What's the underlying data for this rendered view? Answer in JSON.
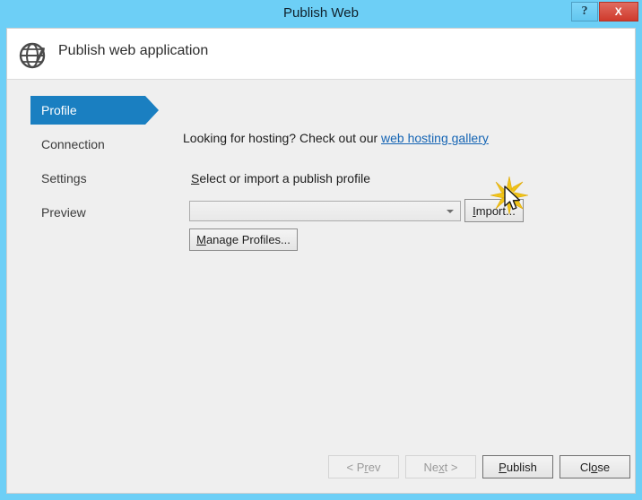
{
  "window": {
    "title": "Publish Web",
    "help_button_label": "?",
    "close_button_label": "X",
    "frame_color": "#6dcff6",
    "close_button_color": "#cf3a2c"
  },
  "header": {
    "icon": "globe-publish-icon",
    "title": "Publish web application"
  },
  "sidebar": {
    "active_color": "#1a7fc1",
    "items": [
      {
        "label": "Profile",
        "active": true
      },
      {
        "label": "Connection",
        "active": false
      },
      {
        "label": "Settings",
        "active": false
      },
      {
        "label": "Preview",
        "active": false
      }
    ]
  },
  "content": {
    "hosting_prefix": "Looking for hosting? Check out our ",
    "hosting_link": "web hosting gallery",
    "hosting_link_color": "#1464b4",
    "select_label_accel": "S",
    "select_label_rest": "elect or import a publish profile",
    "profile_combo": {
      "value": "",
      "placeholder": "",
      "chevron": "chevron-down-icon"
    },
    "import_button": {
      "accel": "I",
      "rest": "mport..."
    },
    "manage_button": {
      "accel": "M",
      "rest": "anage Profiles..."
    }
  },
  "footer": {
    "buttons": [
      {
        "name": "prev",
        "pre": "< P",
        "accel": "r",
        "post": "ev",
        "disabled": true
      },
      {
        "name": "next",
        "pre": "Ne",
        "accel": "x",
        "post": "t >",
        "disabled": true
      },
      {
        "name": "publish",
        "pre": "",
        "accel": "P",
        "post": "ublish",
        "disabled": false
      },
      {
        "name": "close",
        "pre": "Cl",
        "accel": "o",
        "post": "se",
        "disabled": false
      }
    ]
  },
  "overlay": {
    "click_burst": "click-burst-effect",
    "cursor": "mouse-pointer-cursor",
    "burst_color": "#f5c518"
  }
}
